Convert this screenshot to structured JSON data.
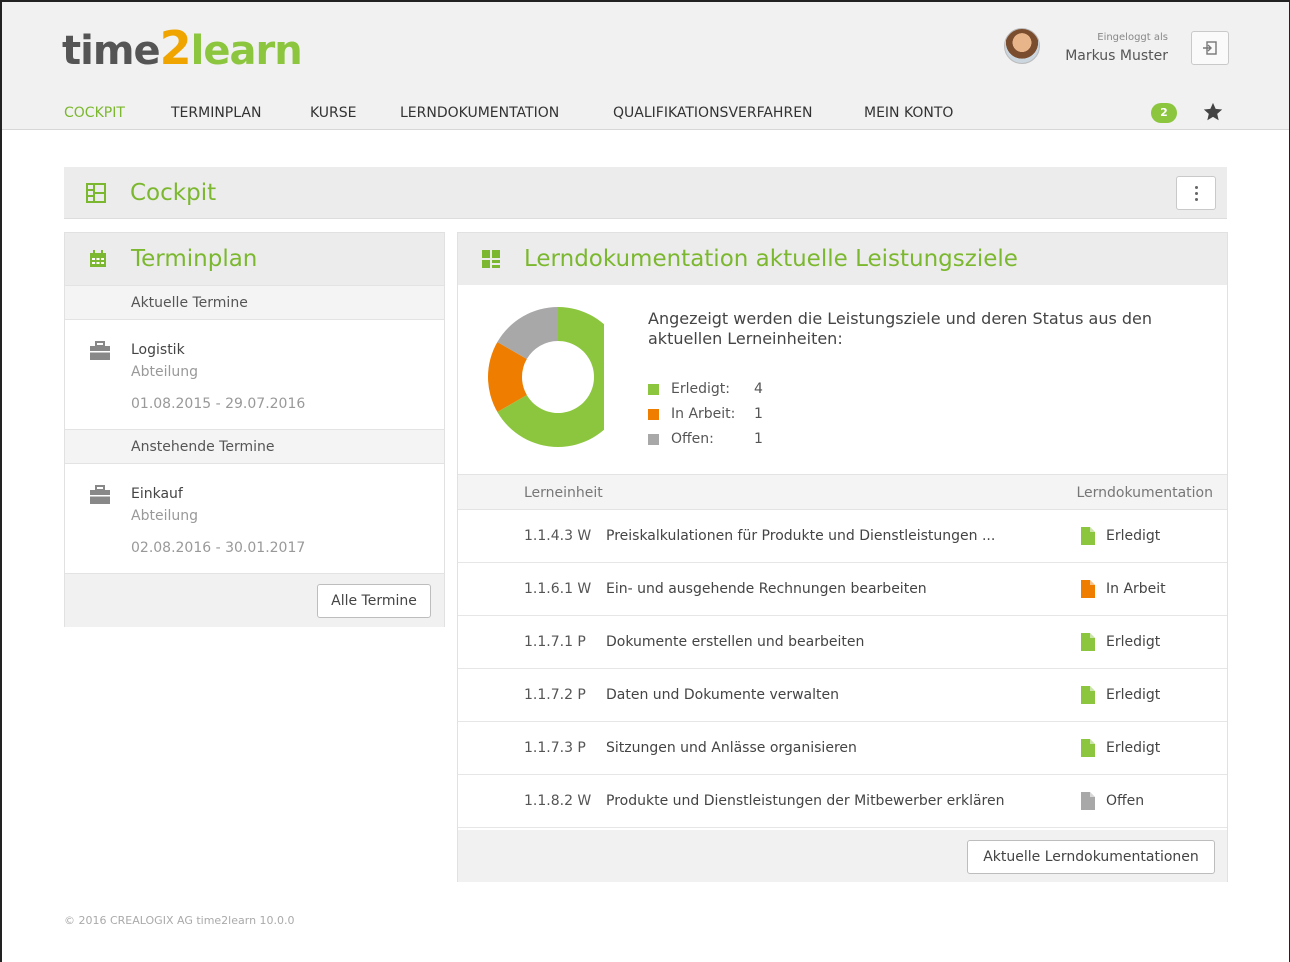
{
  "brand": {
    "part1": "time",
    "part2": "2",
    "part3": "learn"
  },
  "user": {
    "logged_in_label": "Eingeloggt als",
    "name": "Markus Muster"
  },
  "nav": [
    {
      "label": "COCKPIT",
      "active": true
    },
    {
      "label": "TERMINPLAN",
      "active": false
    },
    {
      "label": "KURSE",
      "active": false
    },
    {
      "label": "LERNDOKUMENTATION",
      "active": false
    },
    {
      "label": "QUALIFIKATIONSVERFAHREN",
      "active": false
    },
    {
      "label": "MEIN KONTO",
      "active": false
    }
  ],
  "notifications": {
    "count": "2"
  },
  "page": {
    "title": "Cockpit"
  },
  "terminplan": {
    "title": "Terminplan",
    "current_header": "Aktuelle Termine",
    "current": {
      "name": "Logistik",
      "type": "Abteilung",
      "dates": "01.08.2015 - 29.07.2016"
    },
    "upcoming_header": "Anstehende Termine",
    "upcoming": {
      "name": "Einkauf",
      "type": "Abteilung",
      "dates": "02.08.2016 - 30.01.2017"
    },
    "button": "Alle Termine"
  },
  "lerndoku": {
    "title": "Lerndokumentation aktuelle Leistungsziele",
    "intro": "Angezeigt werden die Leistungsziele und deren Status aus den aktuellen Lerneinheiten:",
    "legend": [
      {
        "label": "Erledigt:",
        "count": "4",
        "color": "#8cc63f"
      },
      {
        "label": "In Arbeit:",
        "count": "1",
        "color": "#ee7d00"
      },
      {
        "label": "Offen:",
        "count": "1",
        "color": "#a8a8a8"
      }
    ],
    "col_unit": "Lerneinheit",
    "col_doc": "Lerndokumentation",
    "rows": [
      {
        "code": "1.1.4.3 W",
        "desc": "Preiskalkulationen für Produkte und Dienstleistungen ...",
        "status": "Erledigt",
        "color": "#8cc63f"
      },
      {
        "code": "1.1.6.1 W",
        "desc": "Ein- und ausgehende Rechnungen bearbeiten",
        "status": "In Arbeit",
        "color": "#ee7d00"
      },
      {
        "code": "1.1.7.1 P",
        "desc": "Dokumente erstellen und bearbeiten",
        "status": "Erledigt",
        "color": "#8cc63f"
      },
      {
        "code": "1.1.7.2 P",
        "desc": "Daten und Dokumente verwalten",
        "status": "Erledigt",
        "color": "#8cc63f"
      },
      {
        "code": "1.1.7.3 P",
        "desc": "Sitzungen und Anlässe organisieren",
        "status": "Erledigt",
        "color": "#8cc63f"
      },
      {
        "code": "1.1.8.2 W",
        "desc": "Produkte und Dienstleistungen der Mitbewerber erklären",
        "status": "Offen",
        "color": "#a8a8a8"
      }
    ],
    "button": "Aktuelle Lerndokumentationen"
  },
  "chart_data": {
    "type": "pie",
    "categories": [
      "Erledigt",
      "In Arbeit",
      "Offen"
    ],
    "values": [
      4,
      1,
      1
    ],
    "colors": [
      "#8cc63f",
      "#ee7d00",
      "#a8a8a8"
    ]
  },
  "footer": {
    "text": "© 2016 CREALOGIX AG   time2learn 10.0.0"
  }
}
